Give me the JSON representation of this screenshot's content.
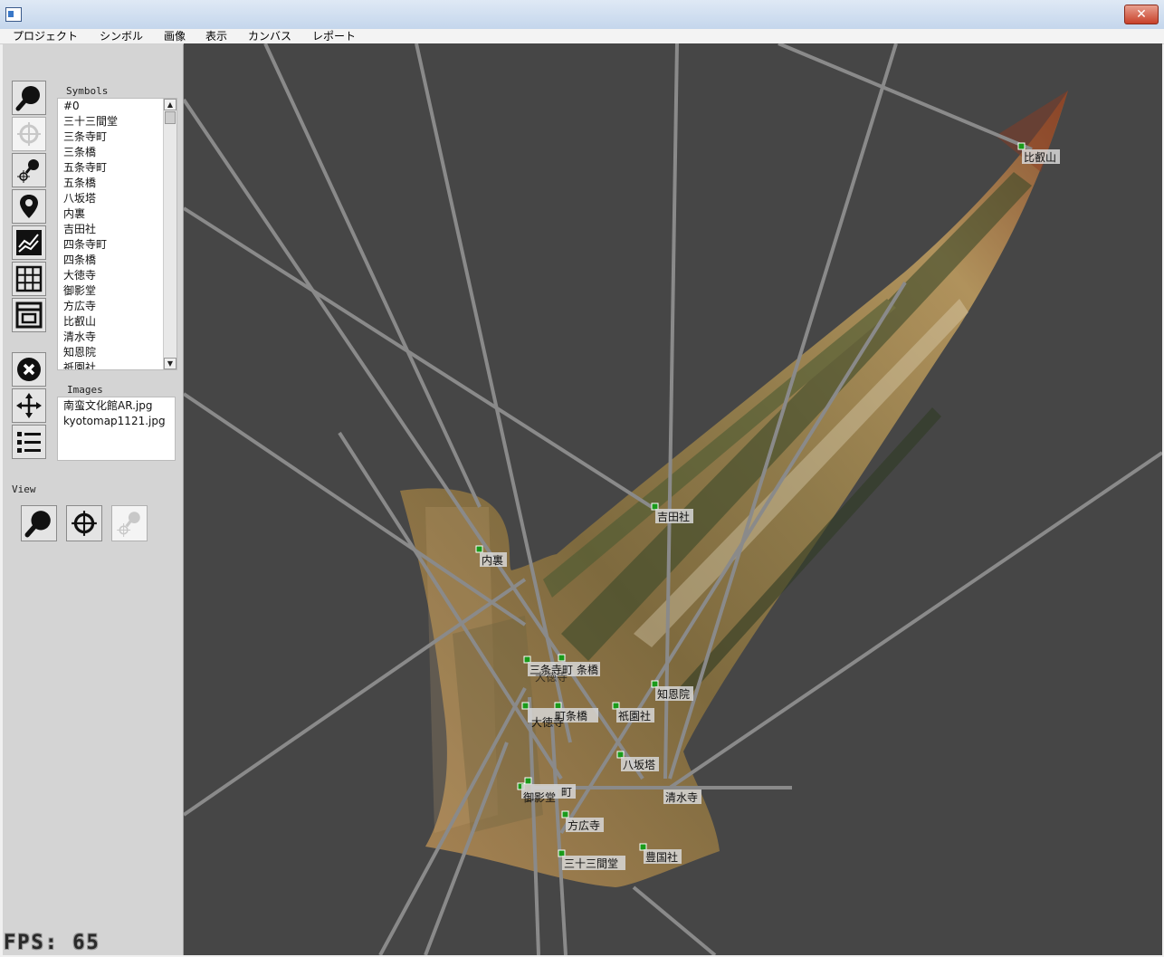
{
  "window": {
    "close_label": "✕"
  },
  "menu": [
    "プロジェクト",
    "シンボル",
    "画像",
    "表示",
    "カンバス",
    "レポート"
  ],
  "symbols": {
    "label": "Symbols",
    "items": [
      "#0",
      "三十三間堂",
      "三条寺町",
      "三条橋",
      "五条寺町",
      "五条橋",
      "八坂塔",
      "内裏",
      "吉田社",
      "四条寺町",
      "四条橋",
      "大徳寺",
      "御影堂",
      "方広寺",
      "比叡山",
      "清水寺",
      "知恩院",
      "祇園社"
    ]
  },
  "images": {
    "label": "Images",
    "items": [
      "南蛮文化館AR.jpg",
      "kyotomap1121.jpg"
    ]
  },
  "view": {
    "label": "View"
  },
  "tools": [
    "zoom-tool",
    "target-tool",
    "place-symbol-tool",
    "pin-tool",
    "graph-tool",
    "grid-tool",
    "layout-tool",
    "delete-tool",
    "move-tool",
    "list-tool"
  ],
  "map_labels": {
    "hieizan": "比叡山",
    "yoshida": "吉田社",
    "dairi": "内裏",
    "sanjo_teramachi": "三条寺町",
    "sanjo_bashi": "条橋",
    "daitokuji_under": "大徳寺",
    "chionin": "知恩院",
    "shijo_teramachi": "町条橋",
    "gionsha": "祇園社",
    "daitokuji": "大徳寺",
    "yasaka": "八坂塔",
    "gojo_teramachi": "町",
    "mieido": "御影堂",
    "kiyomizu": "清水寺",
    "hokoji": "方広寺",
    "hokokusha": "豊国社",
    "sanjusangendo": "三十三間堂"
  },
  "fps": "FPS: 65"
}
